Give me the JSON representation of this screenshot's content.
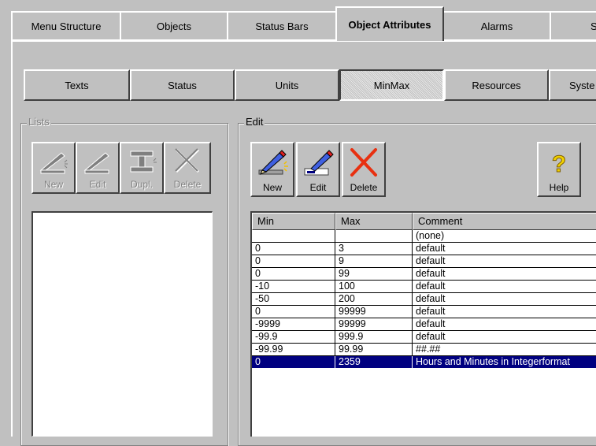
{
  "tabs": [
    {
      "label": "Menu Structure",
      "active": false
    },
    {
      "label": "Objects",
      "active": false
    },
    {
      "label": "Status Bars",
      "active": false
    },
    {
      "label": "Object Attributes",
      "active": true
    },
    {
      "label": "Alarms",
      "active": false
    },
    {
      "label": "Sy",
      "active": false
    }
  ],
  "subtabs": [
    {
      "label": "Texts",
      "pressed": false
    },
    {
      "label": "Status",
      "pressed": false
    },
    {
      "label": "Units",
      "pressed": false
    },
    {
      "label": "MinMax",
      "pressed": true
    },
    {
      "label": "Resources",
      "pressed": false
    },
    {
      "label": "Syste",
      "pressed": false
    }
  ],
  "lists": {
    "title": "Lists",
    "buttons": [
      {
        "label": "New",
        "icon": "new-icon"
      },
      {
        "label": "Edit",
        "icon": "edit-icon"
      },
      {
        "label": "Dupl.",
        "icon": "duplicate-icon"
      },
      {
        "label": "Delete",
        "icon": "delete-icon"
      }
    ]
  },
  "edit": {
    "title": "Edit",
    "buttons": [
      {
        "label": "New",
        "icon": "pencil-new-icon"
      },
      {
        "label": "Edit",
        "icon": "pencil-edit-icon"
      },
      {
        "label": "Delete",
        "icon": "red-x-delete-icon"
      }
    ],
    "help_label": "Help"
  },
  "table": {
    "columns": [
      "Min",
      "Max",
      "Comment"
    ],
    "rows": [
      {
        "min": "",
        "max": "",
        "comment": "(none)"
      },
      {
        "min": "0",
        "max": "3",
        "comment": "default"
      },
      {
        "min": "0",
        "max": "9",
        "comment": "default"
      },
      {
        "min": "0",
        "max": "99",
        "comment": "default"
      },
      {
        "min": "-10",
        "max": "100",
        "comment": "default"
      },
      {
        "min": "-50",
        "max": "200",
        "comment": "default"
      },
      {
        "min": "0",
        "max": "99999",
        "comment": "default"
      },
      {
        "min": "-9999",
        "max": "99999",
        "comment": "default"
      },
      {
        "min": "-99.9",
        "max": "999.9",
        "comment": "default"
      },
      {
        "min": "-99.99",
        "max": "99.99",
        "comment": "##.##"
      },
      {
        "min": "0",
        "max": "2359",
        "comment": "Hours and Minutes in Integerformat"
      }
    ],
    "selected_index": 10
  },
  "colors": {
    "face": "#c0c0c0",
    "selection": "#000080",
    "delete_red": "#e83010",
    "help_yellow": "#f0d000"
  }
}
